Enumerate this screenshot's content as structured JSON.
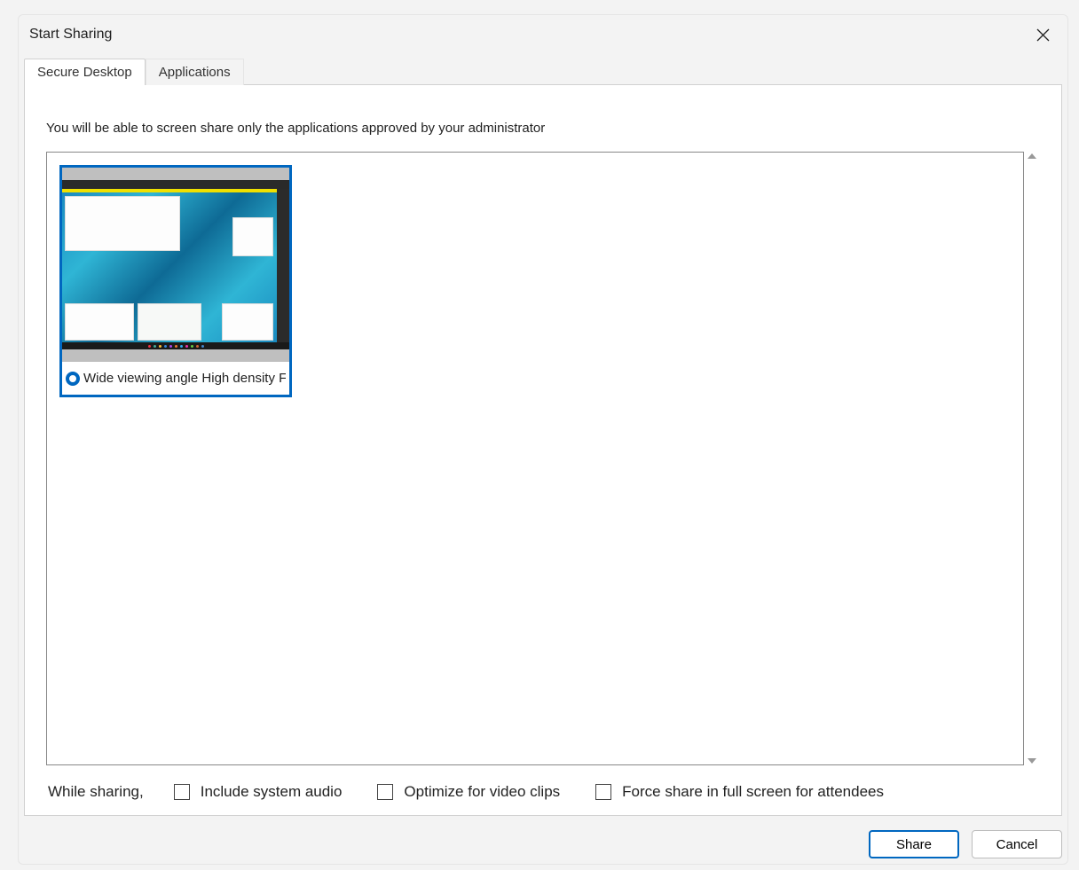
{
  "dialog": {
    "title": "Start Sharing",
    "tabs": [
      {
        "label": "Secure Desktop",
        "active": true
      },
      {
        "label": "Applications",
        "active": false
      }
    ],
    "info_text": "You will be able to screen share only the applications approved by your administrator",
    "screens": [
      {
        "label": "Wide viewing angle  High density F",
        "selected": true
      }
    ],
    "options_prefix": "While sharing,",
    "options": [
      {
        "label": "Include system audio",
        "checked": false
      },
      {
        "label": "Optimize for video clips",
        "checked": false
      },
      {
        "label": "Force share in full screen for attendees",
        "checked": false
      }
    ],
    "buttons": {
      "primary": "Share",
      "secondary": "Cancel"
    }
  }
}
